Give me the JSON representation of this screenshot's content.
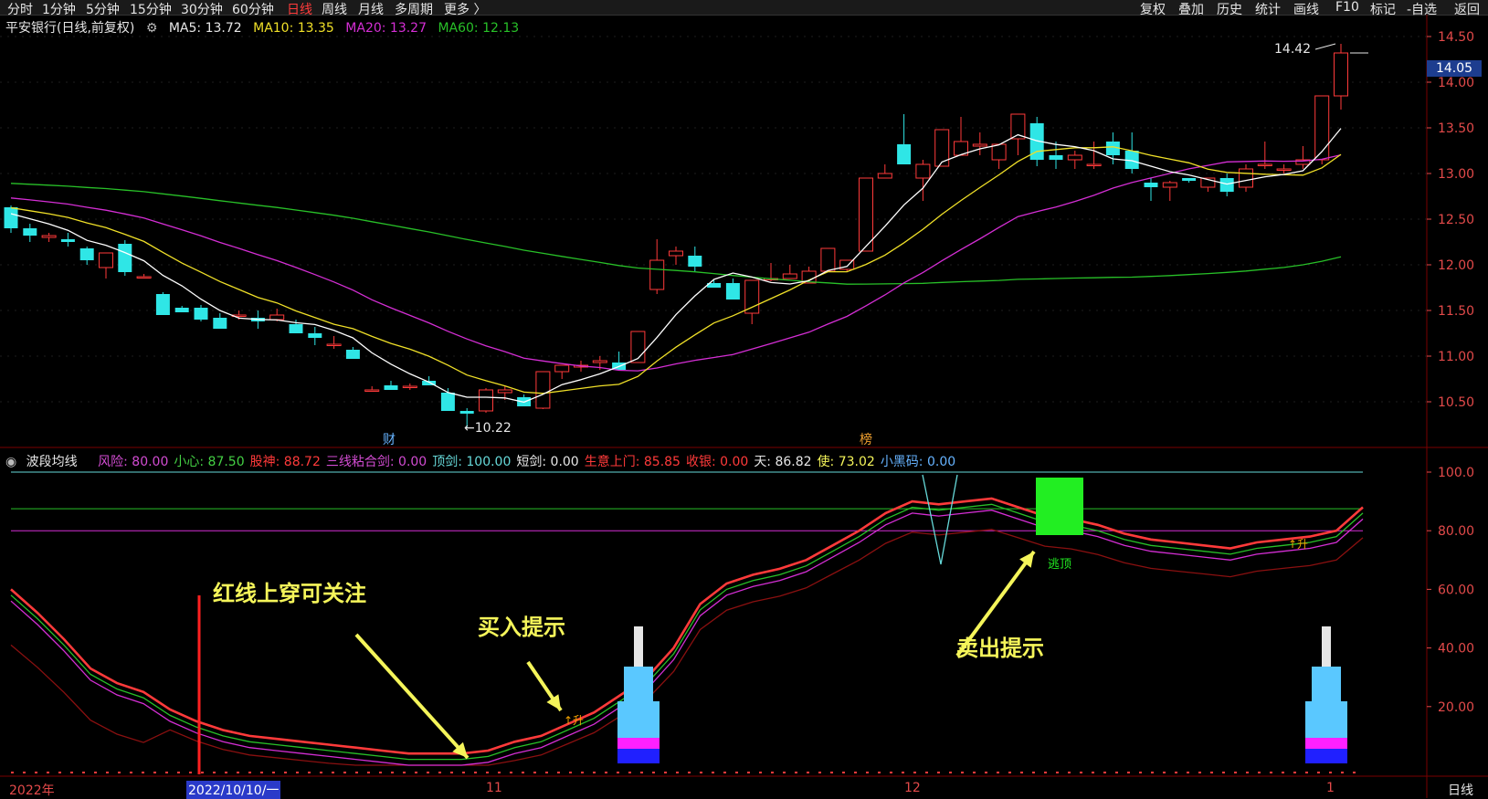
{
  "toolbar": {
    "periods": [
      "分时",
      "1分钟",
      "5分钟",
      "15分钟",
      "30分钟",
      "60分钟",
      "日线",
      "周线",
      "月线",
      "多周期",
      "更多 〉"
    ],
    "active_period": "日线",
    "right_buttons": [
      "复权",
      "叠加",
      "历史",
      "统计",
      "画线",
      "F10",
      "标记",
      "-自选",
      "返回"
    ]
  },
  "main_chart": {
    "stock": "平安银行(日线,前复权)",
    "ma5": "MA5: 13.72",
    "ma10": "MA10: 13.35",
    "ma20": "MA20: 13.27",
    "ma60": "MA60: 12.13",
    "high_label": "14.42",
    "low_label": "←10.22",
    "current_price": "14.05",
    "marker_cai": "财",
    "marker_bang": "榜",
    "y_ticks": [
      "14.50",
      "14.00",
      "13.50",
      "13.00",
      "12.50",
      "12.00",
      "11.50",
      "11.00",
      "10.50"
    ]
  },
  "indicator": {
    "name": "波段均线",
    "values": [
      {
        "text": "风险: 80.00",
        "color": "#d24cd2"
      },
      {
        "text": "小心: 87.50",
        "color": "#44d044"
      },
      {
        "text": "股神: 88.72",
        "color": "#ff3a3a"
      },
      {
        "text": "三线粘合剑: 0.00",
        "color": "#d24cd2"
      },
      {
        "text": "顶剑: 100.00",
        "color": "#66d9d9"
      },
      {
        "text": "短剑: 0.00",
        "color": "#e6e6e6"
      },
      {
        "text": "生意上门: 85.85",
        "color": "#ff3a3a"
      },
      {
        "text": "收银: 0.00",
        "color": "#ff3a3a"
      },
      {
        "text": "天: 86.82",
        "color": "#e6e6e6"
      },
      {
        "text": "使: 73.02",
        "color": "#f5f55a"
      },
      {
        "text": "小黑码: 0.00",
        "color": "#66b3ff"
      }
    ],
    "y_ticks": [
      "100.0",
      "80.00",
      "60.00",
      "40.00",
      "20.00"
    ],
    "label_sheng1": "↑升",
    "label_sheng2": "↑升",
    "label_taoding": "逃顶"
  },
  "annotations": {
    "red_line_cross": "红线上穿可关注",
    "buy_hint": "买入提示",
    "sell_hint": "卖出提示"
  },
  "x_axis": {
    "year": "2022年",
    "selected_date": "2022/10/10/一",
    "month_11": "11",
    "month_12": "12",
    "month_1": "1",
    "period_label": "日线"
  },
  "chart_data": {
    "type": "candlestick",
    "candles_ohlc": [
      [
        12.63,
        12.65,
        12.35,
        12.4
      ],
      [
        12.4,
        12.45,
        12.25,
        12.32
      ],
      [
        12.3,
        12.35,
        12.25,
        12.32
      ],
      [
        12.28,
        12.35,
        12.2,
        12.25
      ],
      [
        12.18,
        12.2,
        12.0,
        12.05
      ],
      [
        11.97,
        12.1,
        11.85,
        12.13
      ],
      [
        12.23,
        12.27,
        11.88,
        11.92
      ],
      [
        11.87,
        11.9,
        11.85,
        11.87
      ],
      [
        11.68,
        11.7,
        11.45,
        11.45
      ],
      [
        11.53,
        11.55,
        11.48,
        11.48
      ],
      [
        11.53,
        11.56,
        11.38,
        11.4
      ],
      [
        11.42,
        11.47,
        11.3,
        11.3
      ],
      [
        11.45,
        11.5,
        11.4,
        11.45
      ],
      [
        11.42,
        11.5,
        11.3,
        11.38
      ],
      [
        11.4,
        11.52,
        11.38,
        11.45
      ],
      [
        11.35,
        11.4,
        11.25,
        11.25
      ],
      [
        11.25,
        11.32,
        11.12,
        11.2
      ],
      [
        11.13,
        11.22,
        11.08,
        11.13
      ],
      [
        11.07,
        11.1,
        10.97,
        10.97
      ],
      [
        10.63,
        10.67,
        10.63,
        10.63
      ],
      [
        10.68,
        10.73,
        10.63,
        10.63
      ],
      [
        10.67,
        10.7,
        10.63,
        10.67
      ],
      [
        10.73,
        10.78,
        10.68,
        10.68
      ],
      [
        10.6,
        10.65,
        10.4,
        10.4
      ],
      [
        10.4,
        10.43,
        10.22,
        10.37
      ],
      [
        10.4,
        10.65,
        10.38,
        10.63
      ],
      [
        10.6,
        10.67,
        10.52,
        10.63
      ],
      [
        10.55,
        10.58,
        10.45,
        10.45
      ],
      [
        10.43,
        10.83,
        10.42,
        10.83
      ],
      [
        10.83,
        10.9,
        10.75,
        10.9
      ],
      [
        10.88,
        10.95,
        10.83,
        10.9
      ],
      [
        10.93,
        11.0,
        10.85,
        10.95
      ],
      [
        10.93,
        11.05,
        10.85,
        10.85
      ],
      [
        10.93,
        11.27,
        10.93,
        11.27
      ],
      [
        11.73,
        12.28,
        11.68,
        12.05
      ],
      [
        12.1,
        12.2,
        12.0,
        12.15
      ],
      [
        12.1,
        12.2,
        11.93,
        11.98
      ],
      [
        11.8,
        11.83,
        11.75,
        11.75
      ],
      [
        11.8,
        11.85,
        11.62,
        11.62
      ],
      [
        11.47,
        11.83,
        11.35,
        11.83
      ],
      [
        11.85,
        12.02,
        11.82,
        11.85
      ],
      [
        11.85,
        12.0,
        11.85,
        11.9
      ],
      [
        11.8,
        11.98,
        11.8,
        11.93
      ],
      [
        11.93,
        12.18,
        11.93,
        12.18
      ],
      [
        11.95,
        12.05,
        11.93,
        12.05
      ],
      [
        12.15,
        12.95,
        12.15,
        12.95
      ],
      [
        12.95,
        13.1,
        12.95,
        13.0
      ],
      [
        13.32,
        13.65,
        13.1,
        13.1
      ],
      [
        12.95,
        13.15,
        12.7,
        13.1
      ],
      [
        13.08,
        13.45,
        13.08,
        13.48
      ],
      [
        13.2,
        13.62,
        13.2,
        13.35
      ],
      [
        13.3,
        13.45,
        13.2,
        13.32
      ],
      [
        13.15,
        13.3,
        13.05,
        13.32
      ],
      [
        13.38,
        13.6,
        13.2,
        13.65
      ],
      [
        13.55,
        13.62,
        13.08,
        13.15
      ],
      [
        13.2,
        13.35,
        13.05,
        13.15
      ],
      [
        13.15,
        13.25,
        13.05,
        13.2
      ],
      [
        13.1,
        13.35,
        13.05,
        13.1
      ],
      [
        13.35,
        13.45,
        13.1,
        13.2
      ],
      [
        13.25,
        13.45,
        13.0,
        13.05
      ],
      [
        12.9,
        12.95,
        12.7,
        12.85
      ],
      [
        12.85,
        12.92,
        12.7,
        12.9
      ],
      [
        12.95,
        12.95,
        12.9,
        12.92
      ],
      [
        12.85,
        12.95,
        12.8,
        12.95
      ],
      [
        12.95,
        13.0,
        12.75,
        12.8
      ],
      [
        12.85,
        13.1,
        12.8,
        13.05
      ],
      [
        13.1,
        13.35,
        13.05,
        13.1
      ],
      [
        13.05,
        13.1,
        13.0,
        13.05
      ],
      [
        13.1,
        13.3,
        13.05,
        13.15
      ],
      [
        13.15,
        13.35,
        13.1,
        13.85
      ],
      [
        13.85,
        14.42,
        13.7,
        14.32
      ]
    ],
    "ma_colors": {
      "MA5": "#ffffff",
      "MA10": "#f0e028",
      "MA20": "#d42ed4",
      "MA60": "#28c028"
    }
  }
}
